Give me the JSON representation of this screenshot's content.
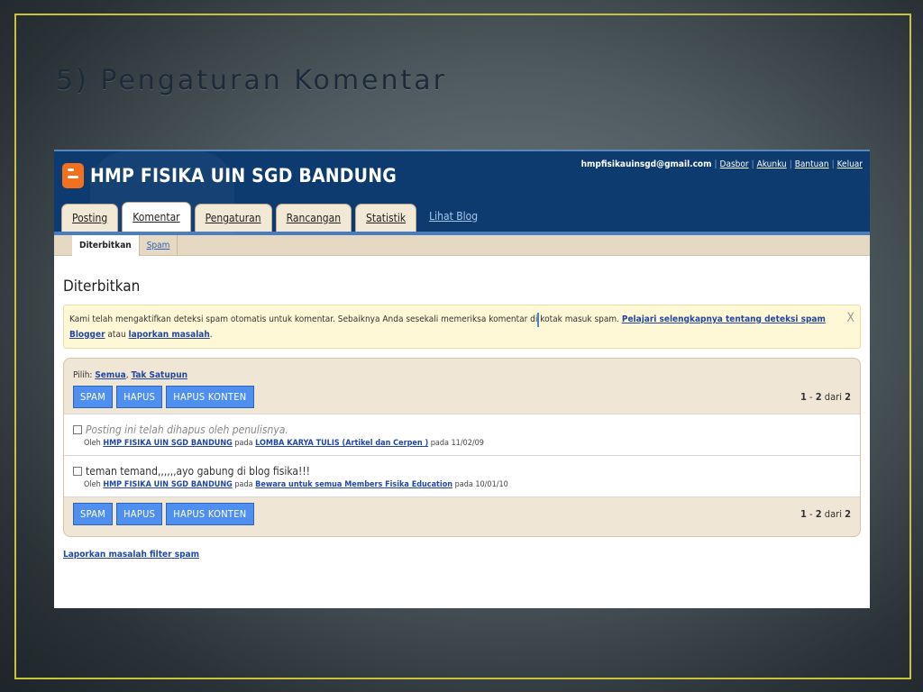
{
  "slide": {
    "title": "5)  Pengaturan Komentar"
  },
  "header": {
    "blog_title": "HMP FISIKA UIN SGD BANDUNG",
    "email": "hmpfisikauinsgd@gmail.com",
    "links": [
      "Dasbor",
      "Akunku",
      "Bantuan",
      "Keluar"
    ]
  },
  "tabs": [
    "Posting",
    "Komentar",
    "Pengaturan",
    "Rancangan",
    "Statistik"
  ],
  "view_blog": "Lihat Blog",
  "subtabs": [
    "Diterbitkan",
    "Spam"
  ],
  "main": {
    "heading": "Diterbitkan",
    "notice": {
      "text": "Kami telah mengaktifkan deteksi spam otomatis untuk komentar. Sebaiknya Anda sesekali memeriksa komentar di kotak masuk spam.",
      "link1": "Pelajari selengkapnya tentang deteksi spam Blogger",
      "middle": "atau",
      "link2": "laporkan masalah",
      "end": ".",
      "close": "X"
    },
    "select": {
      "label": "Pilih:",
      "all": "Semua",
      "comma": ",",
      "none": "Tak Satupun"
    },
    "buttons": {
      "spam": "SPAM",
      "delete": "HAPUS",
      "delete_content": "HAPUS KONTEN"
    },
    "pagination": {
      "range_start": "1",
      "dash": " - ",
      "range_end": "2",
      "of": " dari ",
      "total": "2"
    },
    "comments": [
      {
        "text": "Posting ini telah dihapus oleh penulisnya.",
        "by_label": "Oleh",
        "author": "HMP FISIKA UIN SGD BANDUNG",
        "on_label": "pada",
        "post": "LOMBA KARYA TULIS (Artikel dan Cerpen )",
        "date": "pada 11/02/09"
      },
      {
        "text": "teman temand,,,,,,ayo gabung di blog fisika!!!",
        "by_label": "Oleh",
        "author": "HMP FISIKA UIN SGD BANDUNG",
        "on_label": "pada",
        "post": "Bewara untuk semua Members Fisika Education",
        "date": "pada 10/01/10"
      }
    ],
    "footer_link": "Laporkan masalah filter spam"
  }
}
